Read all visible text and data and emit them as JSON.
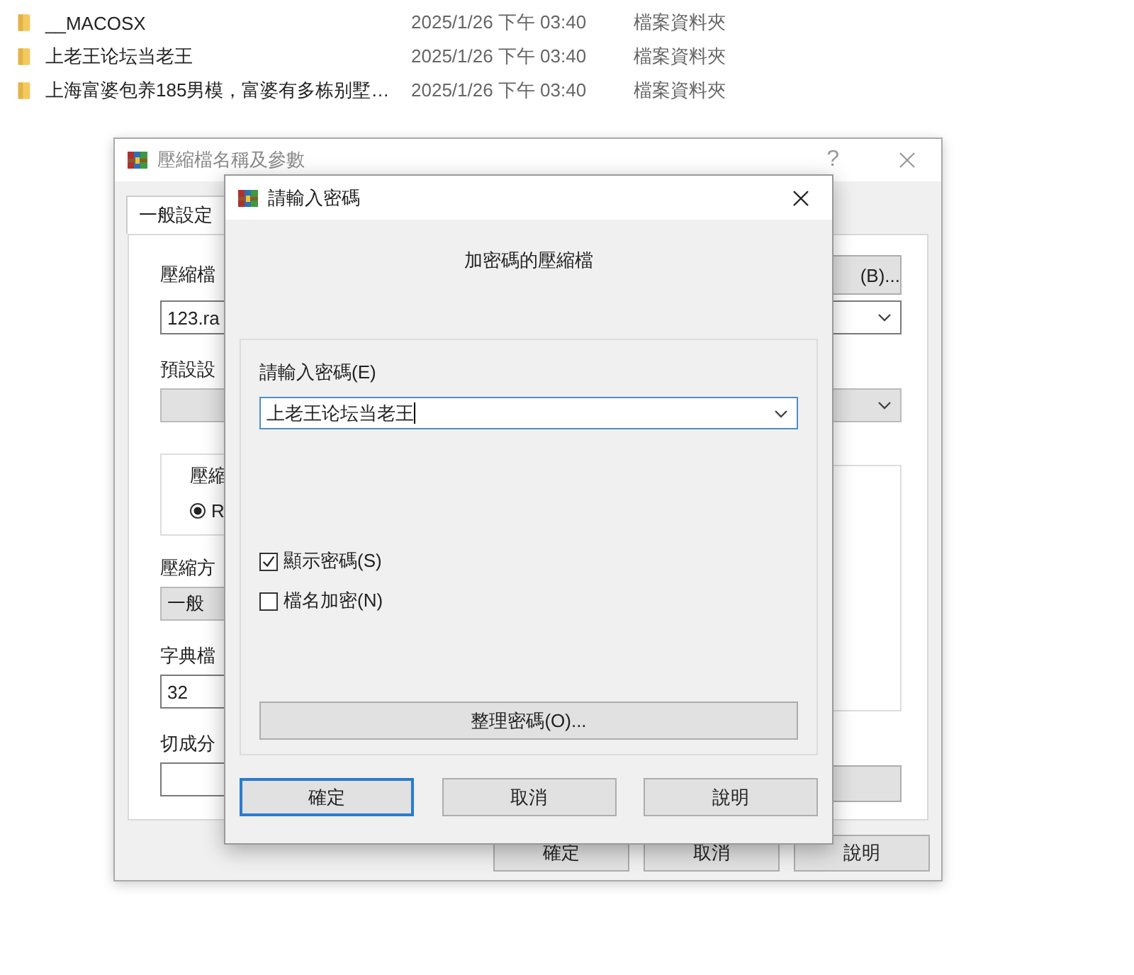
{
  "file_list": [
    {
      "name": "__MACOSX",
      "modified": "2025/1/26 下午 03:40",
      "type": "檔案資料夾"
    },
    {
      "name": "上老王论坛当老王",
      "modified": "2025/1/26 下午 03:40",
      "type": "檔案資料夾"
    },
    {
      "name": "上海富婆包养185男模，富婆有多栋别墅…",
      "modified": "2025/1/26 下午 03:40",
      "type": "檔案資料夾"
    }
  ],
  "background_window": {
    "title": "壓縮檔名稱及參數",
    "help_button": "?",
    "tabs": [
      {
        "label": "一般設定",
        "selected": true
      }
    ],
    "archive_name_label": "壓縮檔",
    "browse_button": "(B)...",
    "archive_name_value": "123.ra",
    "profile_label": "預設設",
    "format_group_label": "壓縮",
    "format_option": {
      "label": "R",
      "checked": true
    },
    "method_label": "壓縮方",
    "method_value": "一般",
    "dictionary_label": "字典檔",
    "dictionary_value": "32",
    "split_label": "切成分",
    "buttons": [
      {
        "label": "確定"
      },
      {
        "label": "取消"
      },
      {
        "label": "說明"
      }
    ]
  },
  "password_dialog": {
    "title": "請輸入密碼",
    "subtitle": "加密碼的壓縮檔",
    "password_label": "請輸入密碼(E)",
    "password_value": "上老王论坛当老王",
    "checkboxes": [
      {
        "label": "顯示密碼(S)",
        "checked": true
      },
      {
        "label": "檔名加密(N)",
        "checked": false
      }
    ],
    "organize_button": "整理密碼(O)...",
    "buttons": [
      {
        "label": "確定",
        "focused": true
      },
      {
        "label": "取消",
        "focused": false
      },
      {
        "label": "說明",
        "focused": false
      }
    ]
  }
}
